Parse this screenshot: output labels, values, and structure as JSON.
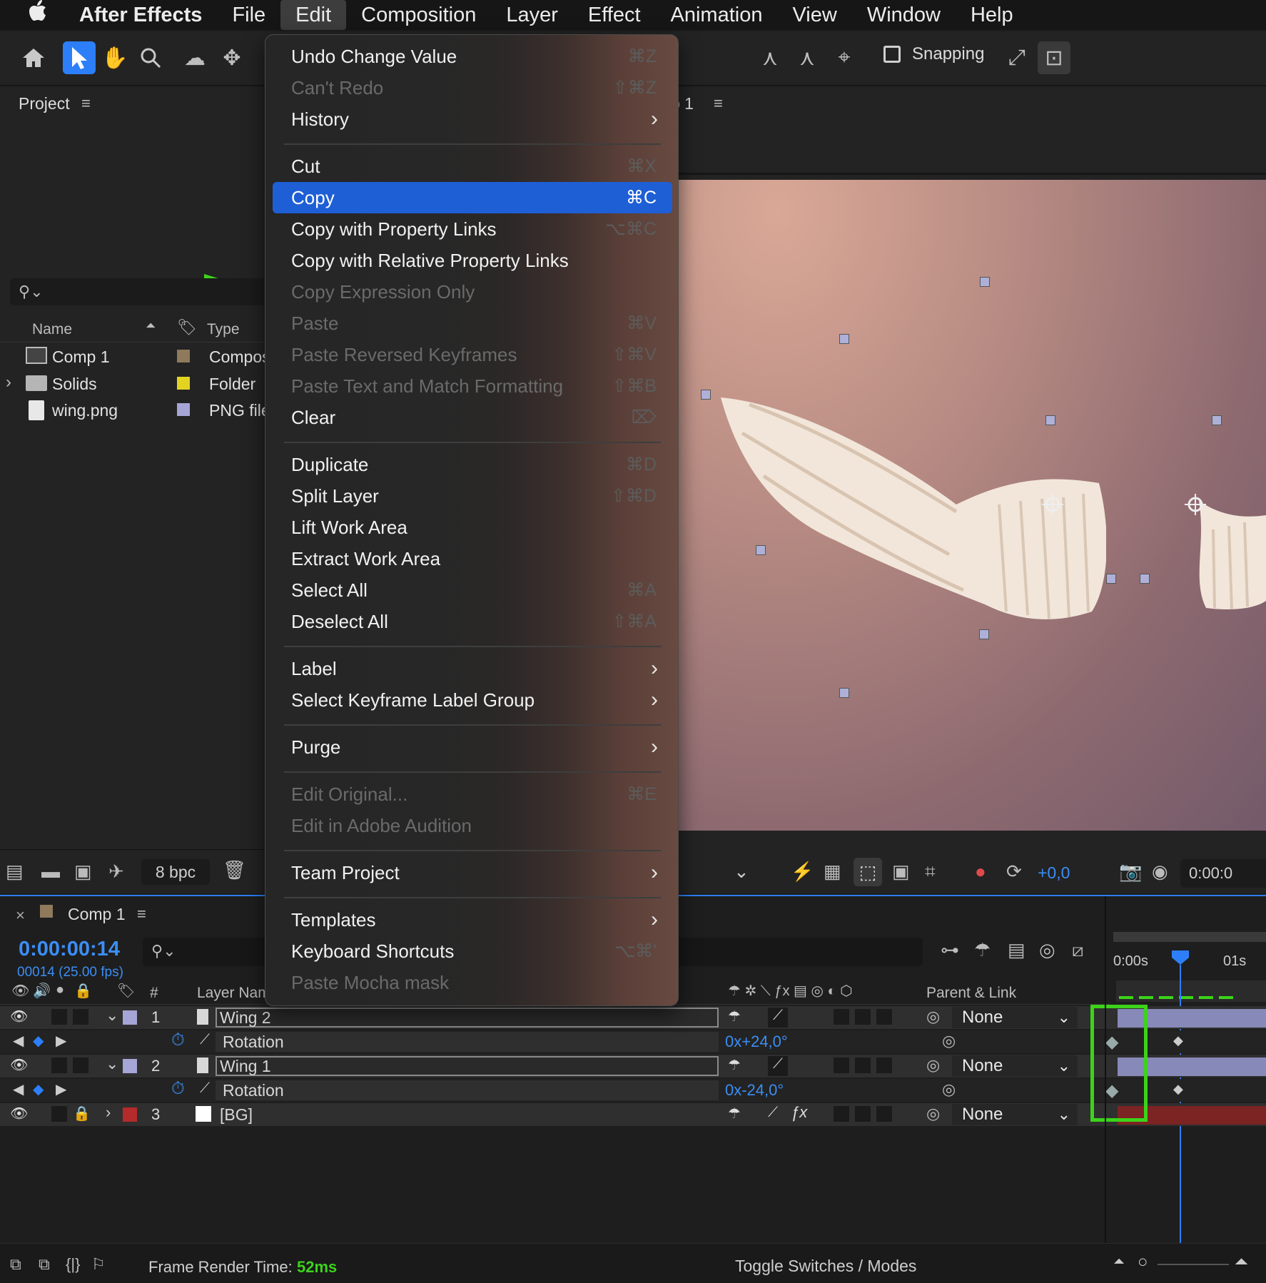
{
  "menubar": {
    "apple": "",
    "items": [
      "After Effects",
      "File",
      "Edit",
      "Composition",
      "Layer",
      "Effect",
      "Animation",
      "View",
      "Window",
      "Help"
    ]
  },
  "toolbar": {
    "snapping_label": "Snapping"
  },
  "project_panel": {
    "title": "Project",
    "columns": {
      "name": "Name",
      "type": "Type"
    },
    "items": [
      {
        "name": "Comp 1",
        "type": "Compos",
        "label_color": "#8f7a5c"
      },
      {
        "name": "Solids",
        "type": "Folder",
        "label_color": "#e3d321"
      },
      {
        "name": "wing.png",
        "type": "PNG file",
        "label_color": "#a5a5d6"
      }
    ],
    "bpc": "8 bpc"
  },
  "viewer": {
    "title_fragment": "p 1",
    "exposure": "+0,0",
    "timecode": "0:00:0"
  },
  "edit_menu": {
    "items": [
      {
        "label": "Undo Change Value",
        "shortcut": "⌘Z",
        "enabled": true
      },
      {
        "label": "Can't Redo",
        "shortcut": "⇧⌘Z",
        "enabled": false
      },
      {
        "label": "History",
        "submenu": true,
        "enabled": true
      },
      {
        "separator": true
      },
      {
        "label": "Cut",
        "shortcut": "⌘X",
        "enabled": true
      },
      {
        "label": "Copy",
        "shortcut": "⌘C",
        "enabled": true,
        "highlighted": true
      },
      {
        "label": "Copy with Property Links",
        "shortcut": "⌥⌘C",
        "enabled": true
      },
      {
        "label": "Copy with Relative Property Links",
        "enabled": true
      },
      {
        "label": "Copy Expression Only",
        "enabled": false
      },
      {
        "label": "Paste",
        "shortcut": "⌘V",
        "enabled": false
      },
      {
        "label": "Paste Reversed Keyframes",
        "shortcut": "⇧⌘V",
        "enabled": false
      },
      {
        "label": "Paste Text and Match Formatting",
        "shortcut": "⇧⌘B",
        "enabled": false
      },
      {
        "label": "Clear",
        "shortcut": "⌦",
        "enabled": true
      },
      {
        "separator": true
      },
      {
        "label": "Duplicate",
        "shortcut": "⌘D",
        "enabled": true
      },
      {
        "label": "Split Layer",
        "shortcut": "⇧⌘D",
        "enabled": true
      },
      {
        "label": "Lift Work Area",
        "enabled": true
      },
      {
        "label": "Extract Work Area",
        "enabled": true
      },
      {
        "label": "Select All",
        "shortcut": "⌘A",
        "enabled": true
      },
      {
        "label": "Deselect All",
        "shortcut": "⇧⌘A",
        "enabled": true
      },
      {
        "separator": true
      },
      {
        "label": "Label",
        "submenu": true,
        "enabled": true
      },
      {
        "label": "Select Keyframe Label Group",
        "submenu": true,
        "enabled": true
      },
      {
        "separator": true
      },
      {
        "label": "Purge",
        "submenu": true,
        "enabled": true
      },
      {
        "separator": true
      },
      {
        "label": "Edit Original...",
        "shortcut": "⌘E",
        "enabled": false
      },
      {
        "label": "Edit in Adobe Audition",
        "enabled": false
      },
      {
        "separator": true
      },
      {
        "label": "Team Project",
        "submenu": true,
        "enabled": true
      },
      {
        "separator": true
      },
      {
        "label": "Templates",
        "submenu": true,
        "enabled": true
      },
      {
        "label": "Keyboard Shortcuts",
        "shortcut": "⌥⌘'",
        "enabled": true
      },
      {
        "label": "Paste Mocha mask",
        "enabled": false
      }
    ]
  },
  "timeline": {
    "comp_tab": "Comp 1",
    "timecode": "0:00:00:14",
    "frame_info": "00014 (25.00 fps)",
    "col_hash": "#",
    "col_layer_name": "Layer Nam",
    "col_parent": "Parent & Link",
    "ruler": {
      "start": "0:00s",
      "one_sec": "01s"
    },
    "layers": [
      {
        "num": "1",
        "name": "Wing 2",
        "label_color": "#a5a5d6",
        "parent": "None",
        "property": "Rotation",
        "value": "0x+24,0°"
      },
      {
        "num": "2",
        "name": "Wing 1",
        "label_color": "#a5a5d6",
        "parent": "None",
        "property": "Rotation",
        "value": "0x-24,0°"
      },
      {
        "num": "3",
        "name": "[BG]",
        "label_color": "#b52a2a",
        "parent": "None"
      }
    ],
    "footer": {
      "render_label": "Frame Render Time:",
      "render_value": "52ms",
      "toggle": "Toggle Switches / Modes"
    }
  },
  "colors": {
    "accent": "#2d7ff9",
    "menu_highlight": "#1e5fd6",
    "annotation_green": "#3cd31a"
  }
}
